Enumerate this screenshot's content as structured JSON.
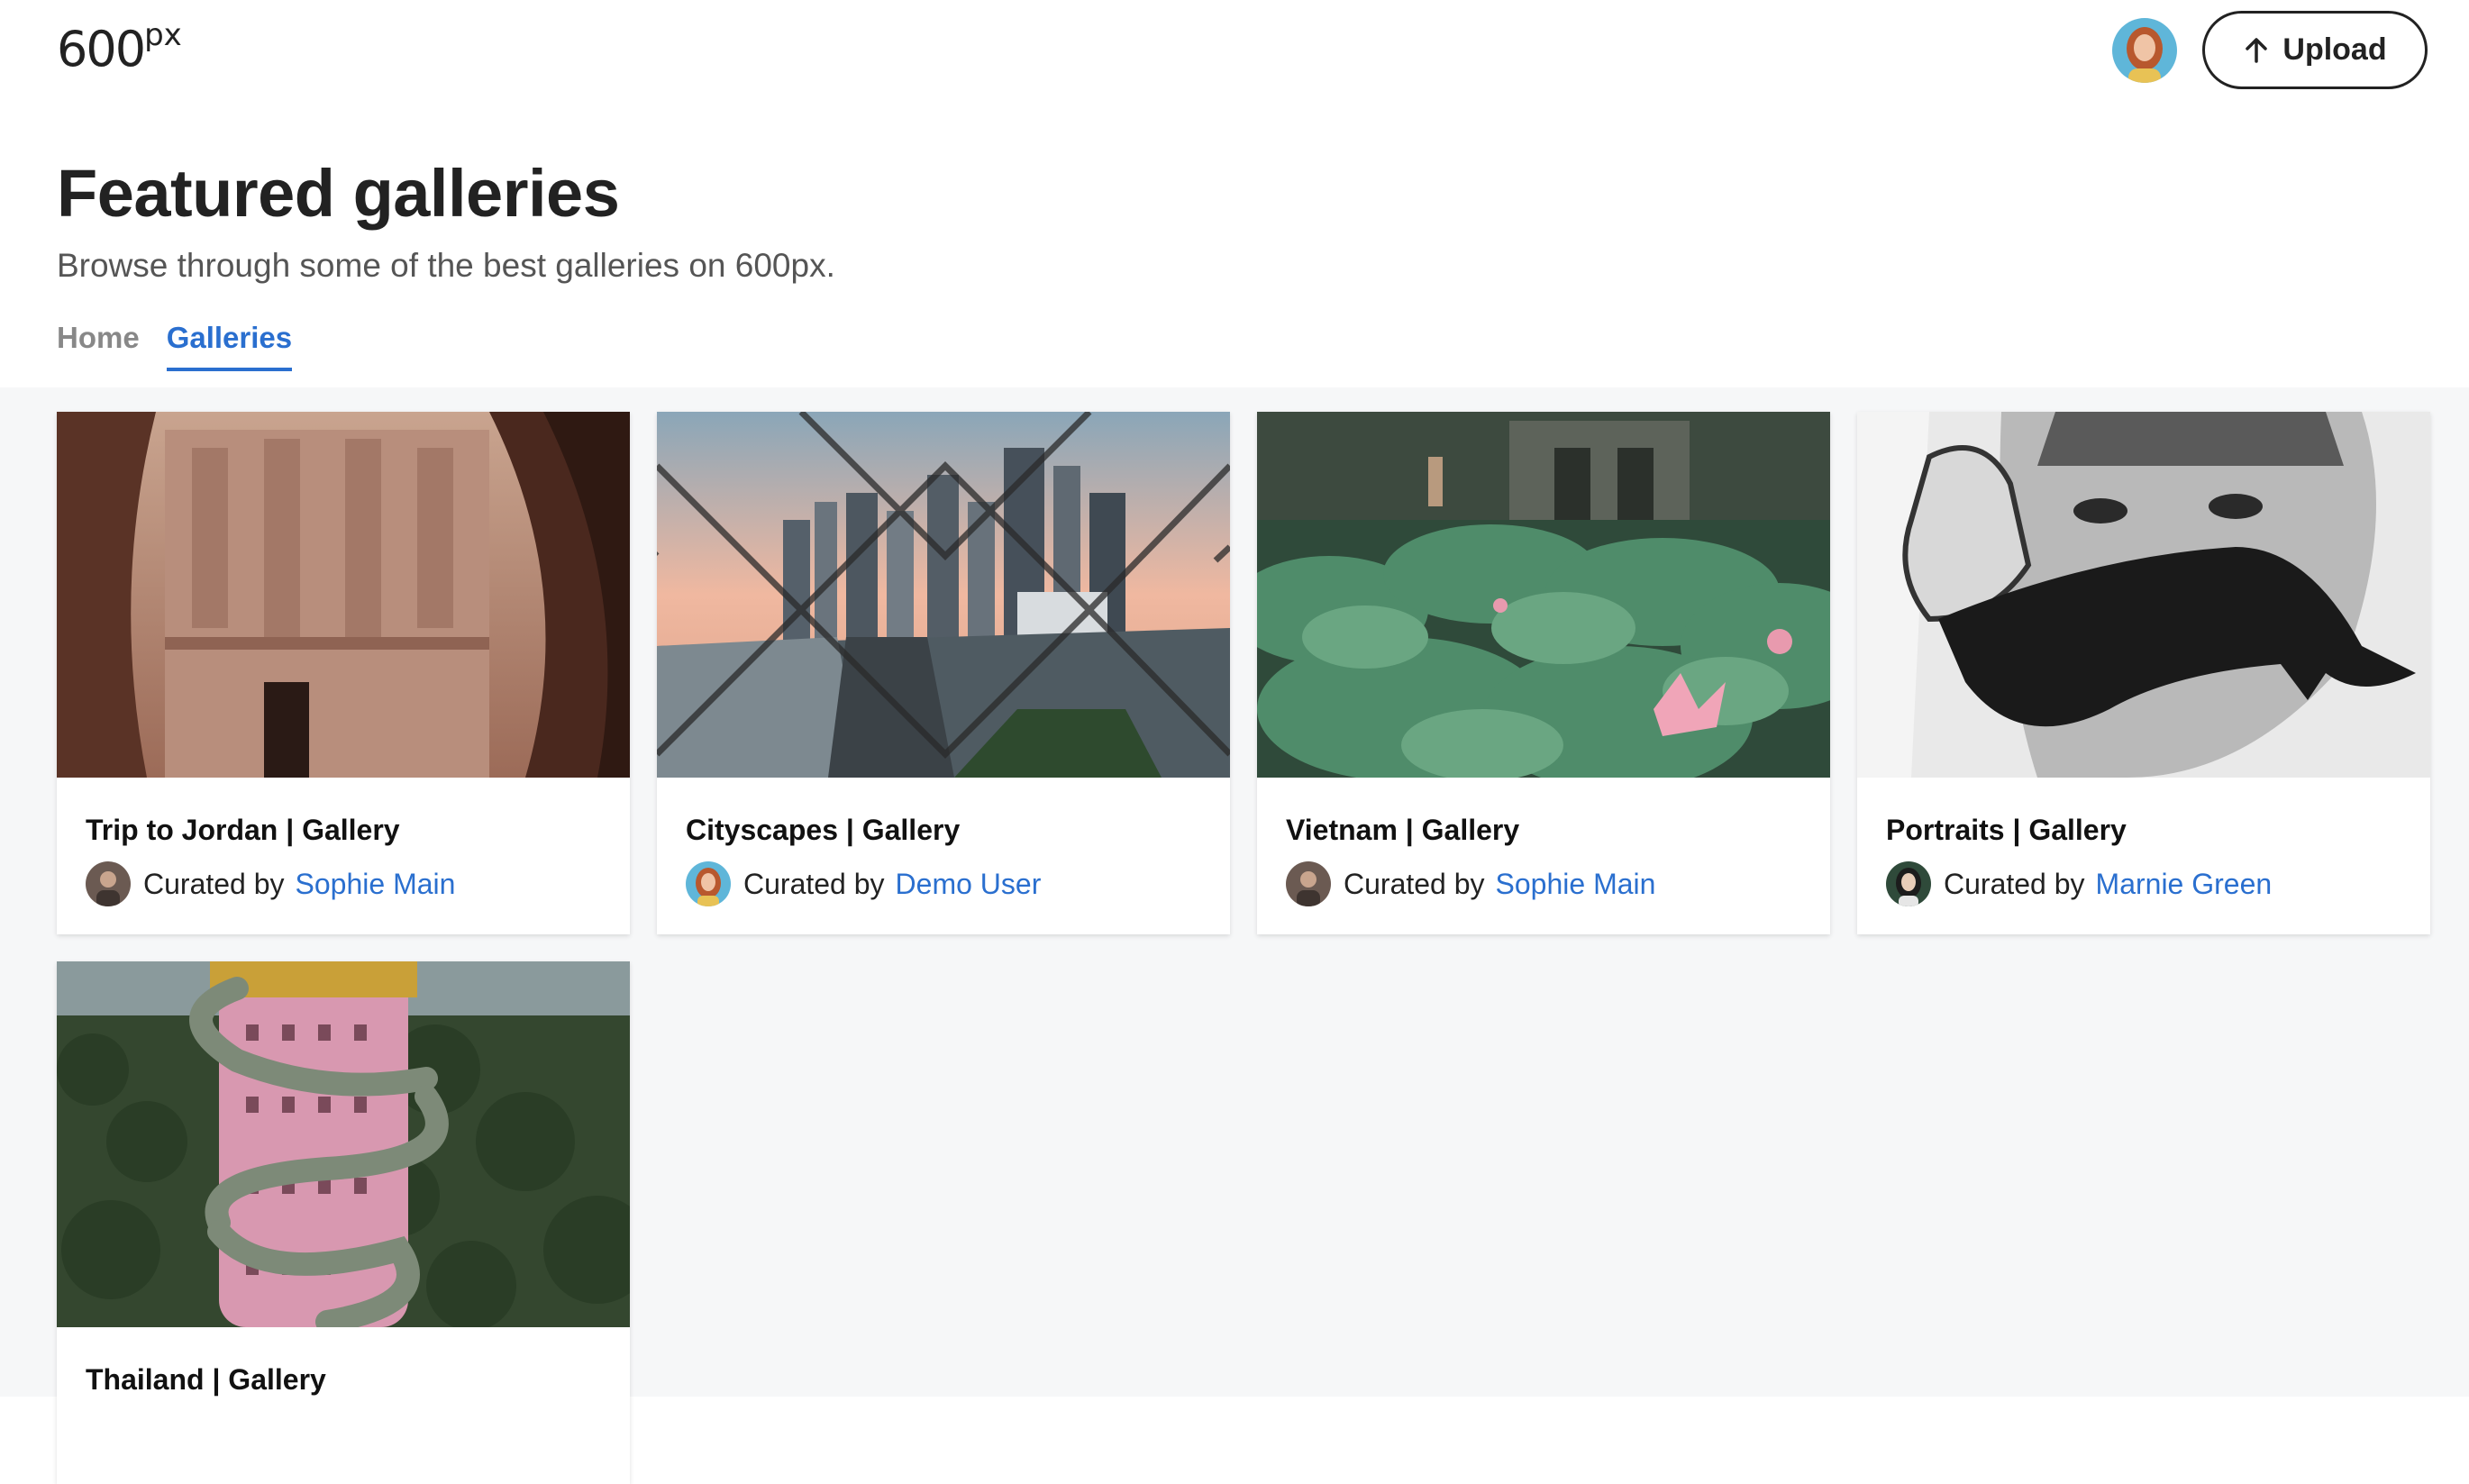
{
  "brand": {
    "logo_main": "600",
    "logo_sup": "px"
  },
  "header": {
    "upload_label": "Upload"
  },
  "page": {
    "title": "Featured galleries",
    "subtitle": "Browse through some of the best galleries on 600px."
  },
  "tabs": [
    {
      "label": "Home",
      "active": false
    },
    {
      "label": "Galleries",
      "active": true
    }
  ],
  "curated_prefix": "Curated by",
  "galleries": [
    {
      "title": "Trip to Jordan | Gallery",
      "curator": "Sophie Main",
      "photo": "Petra treasury rock facade"
    },
    {
      "title": "Cityscapes | Gallery",
      "curator": "Demo User",
      "photo": "City skyline through chain-link fence"
    },
    {
      "title": "Vietnam | Gallery",
      "curator": "Sophie Main",
      "photo": "Lotus pond with temple gate"
    },
    {
      "title": "Portraits | Gallery",
      "curator": "Marnie Green",
      "photo": "Black and white portrait with hand"
    },
    {
      "title": "Thailand | Gallery",
      "curator": "",
      "photo": "Pink tower with dragon over jungle"
    }
  ],
  "colors": {
    "accent": "#2a6fcf",
    "background": "#f6f7f8",
    "text": "#222222"
  }
}
